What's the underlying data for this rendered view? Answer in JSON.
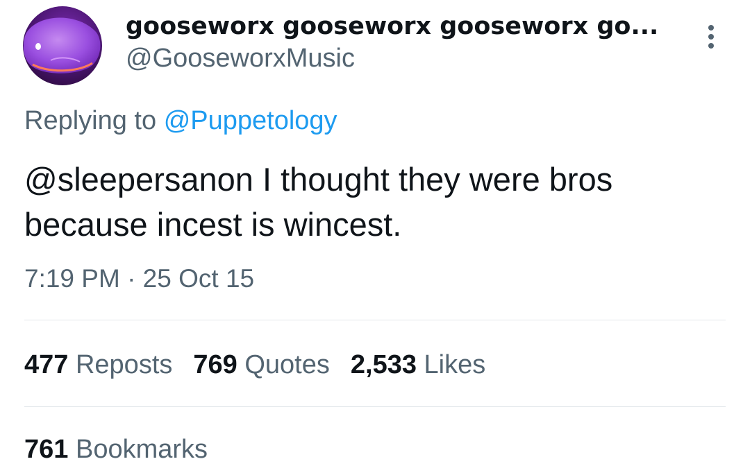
{
  "tweet": {
    "author": {
      "display_name": "gooseworx gooseworx gooseworx go...",
      "handle": "@GooseworxMusic",
      "avatar_icon": "purple-creature-avatar"
    },
    "more_icon": "more-vertical-icon",
    "replying_prefix": "Replying to",
    "replying_to": "@Puppetology",
    "text": "@sleepersanon I thought they were bros because incest is wincest.",
    "timestamp": "7:19 PM · 25 Oct 15",
    "stats": {
      "reposts": {
        "count": "477",
        "label": "Reposts"
      },
      "quotes": {
        "count": "769",
        "label": "Quotes"
      },
      "likes": {
        "count": "2,533",
        "label": "Likes"
      }
    },
    "bookmarks": {
      "count": "761",
      "label": "Bookmarks"
    }
  },
  "colors": {
    "text_primary": "#0f1419",
    "text_secondary": "#536471",
    "link": "#1d9bf0",
    "divider": "#e1e6ea",
    "avatar_purple": "#8a3fd6"
  }
}
